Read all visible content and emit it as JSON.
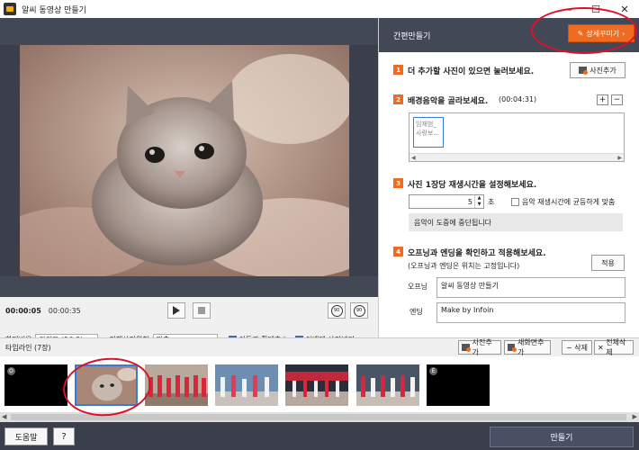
{
  "window": {
    "title": "알씨 동영상 만들기",
    "controls": [
      "—",
      "☐",
      "✕"
    ]
  },
  "player": {
    "current_time": "00:00:05",
    "total_time": "00:00:35",
    "rotate_left": "90",
    "rotate_right": "90"
  },
  "options": {
    "aspect_label": "화면비율",
    "aspect_value": "와이드 (16:9)",
    "position_label": "전체사진위치",
    "position_value": "맞춤",
    "motion_label": "이동과 확대축소",
    "motion_checked": true,
    "margin_label": "여백에 사진넣기",
    "margin_checked": true
  },
  "panel": {
    "title": "간편만들기",
    "decorate_button": "상세꾸미기",
    "step1": {
      "num": "1",
      "title": "더 추가할 사진이 있으면 눌러보세요.",
      "button": "사진추가"
    },
    "step2": {
      "num": "2",
      "title": "배경음악을 골라보세요.",
      "duration": "(00:04:31)",
      "plus": "+",
      "minus": "−",
      "track": "임재범_사랑보..."
    },
    "step3": {
      "num": "3",
      "title": "사진 1장당 재생시간을 설정해보세요.",
      "seconds_value": "5",
      "seconds_unit": "초",
      "sync_label": "음악 재생시간에 균등하게 맞춤",
      "sync_checked": false,
      "info": "음악이 도중에 중단됩니다"
    },
    "step4": {
      "num": "4",
      "title": "오프닝과 엔딩을 확인하고 적용해보세요.",
      "subtitle": "(오프닝과 엔딩은 위치는 고정입니다)",
      "apply_button": "적용",
      "opening_label": "오프닝",
      "opening_value": "알씨 동영상 만들기",
      "ending_label": "엔딩",
      "ending_value": "Make by Infoin"
    }
  },
  "timeline": {
    "label": "타임라인 (7장)",
    "add_photo": "사진추가",
    "add_new_screen": "새화면추가",
    "delete": "삭제",
    "delete_all": "전체삭제",
    "opening_badge": "O",
    "ending_badge": "E"
  },
  "bottom": {
    "help": "도움말",
    "question": "?",
    "make": "만들기"
  },
  "colors": {
    "accent": "#f06a1f",
    "dark": "#3a3f4b",
    "annotation": "#e0102a"
  }
}
